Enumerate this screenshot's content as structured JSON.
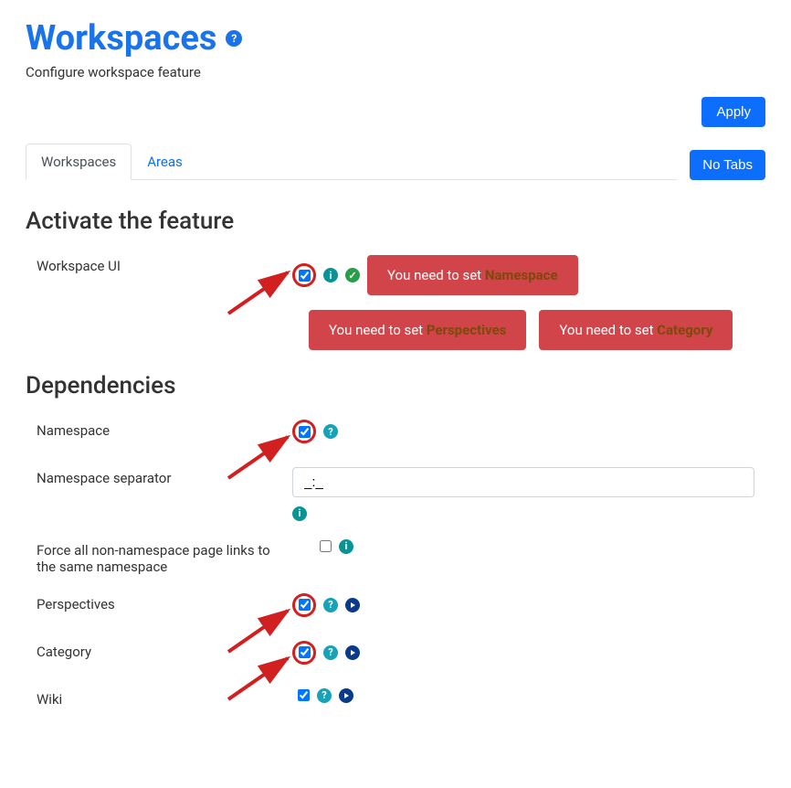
{
  "header": {
    "title": "Workspaces",
    "subtitle": "Configure workspace feature",
    "apply_label": "Apply"
  },
  "tabs": {
    "items": [
      {
        "label": "Workspaces"
      },
      {
        "label": "Areas"
      }
    ],
    "no_tabs_label": "No Tabs"
  },
  "sections": {
    "activate": {
      "title": "Activate the feature",
      "workspace_ui": {
        "label": "Workspace UI",
        "checked": true,
        "alerts": [
          {
            "prefix": "You need to set ",
            "highlight": "Namespace"
          },
          {
            "prefix": "You need to set ",
            "highlight": "Perspectives"
          },
          {
            "prefix": "You need to set ",
            "highlight": "Category"
          }
        ]
      }
    },
    "dependencies": {
      "title": "Dependencies",
      "namespace": {
        "label": "Namespace",
        "checked": true
      },
      "separator": {
        "label": "Namespace separator",
        "value": "_:_"
      },
      "force_links": {
        "label": "Force all non-namespace page links to the same namespace",
        "checked": false
      },
      "perspectives": {
        "label": "Perspectives",
        "checked": true
      },
      "category": {
        "label": "Category",
        "checked": true
      },
      "wiki": {
        "label": "Wiki",
        "checked": true
      }
    }
  }
}
